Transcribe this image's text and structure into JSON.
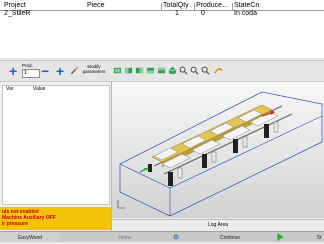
{
  "table": {
    "headers": [
      "Project",
      "Piece",
      "TotalQty",
      "Produce...",
      "StateCn"
    ],
    "rows": [
      [
        "2_StileR",
        "",
        "1",
        "0",
        "In coda"
      ]
    ]
  },
  "toolbar": {
    "prod_label": "Prod.",
    "prod_value": "1",
    "modify_label": "Modify parameters"
  },
  "left_panel": {
    "var_header": "Var",
    "value_header": "Value"
  },
  "messages": {
    "lines": [
      "uis not enabled",
      "Machine Auxiliary OFF",
      "ir pressure"
    ]
  },
  "log_area": {
    "label": "Log Area"
  },
  "bottom_bar": {
    "easywood": "EasyWood",
    "home": "Home",
    "continue": "Continue",
    "right": "St"
  },
  "colors": {
    "message_bg": "#f4c20d",
    "message_text": "#cc0000",
    "accent_blue": "#1f63c8"
  }
}
